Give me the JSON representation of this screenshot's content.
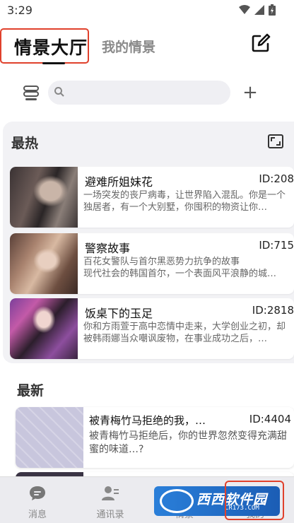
{
  "status_bar": {
    "time": "3:29"
  },
  "header": {
    "tabs": [
      {
        "label": "情景大厅",
        "active": true
      },
      {
        "label": "我的情景",
        "active": false
      }
    ],
    "edit_icon": "edit-icon"
  },
  "search": {
    "value": "",
    "placeholder": ""
  },
  "hot": {
    "title": "最热",
    "items": [
      {
        "title": "避难所姐妹花",
        "id": "ID:208",
        "desc": "一场突发的丧尸病毒，让世界陷入混乱。你是一个独居者，有一个大别墅，你囤积的物资让你…"
      },
      {
        "title": "警察故事",
        "id": "ID:715",
        "desc": "百花女警队与首尔黑恶势力抗争的故事\n现代社会的韩国首尔，一个表面风平浪静的城…"
      },
      {
        "title": "饭桌下的玉足",
        "id": "ID:2818",
        "desc": "你和方雨萱于高中恋情中走来，大学创业之初，却被韩雨娜当众嘲讽废物，在事业成功之后，…"
      }
    ]
  },
  "newest": {
    "title": "最新",
    "items": [
      {
        "title": "被青梅竹马拒绝的我，…",
        "id": "ID:4404",
        "desc": "被青梅竹马拒绝后，你的世界忽然变得充满甜蜜的味道…?"
      }
    ]
  },
  "bottom_nav": {
    "items": [
      {
        "label": "消息"
      },
      {
        "label": "通讯录"
      },
      {
        "label": "情景"
      },
      {
        "label": "我的"
      }
    ]
  },
  "watermark": {
    "text": "西西软件园",
    "sub": "CR173.COM"
  },
  "colors": {
    "highlight": "#e0412c",
    "panel": "#f2f2f5"
  }
}
